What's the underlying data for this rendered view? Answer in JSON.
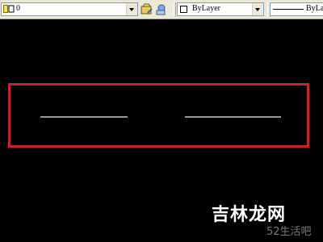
{
  "toolbar": {
    "layer_combo": {
      "value": "0"
    },
    "color_combo": {
      "value": "ByLayer"
    },
    "linetype_combo": {
      "value": "ByLay"
    }
  },
  "watermark": {
    "main_text": "吉林龙网",
    "sub_text": "52生活吧"
  },
  "colors": {
    "selection_frame": "#c0272d",
    "drawn_lines": "#9a9a9a",
    "canvas_background": "#000000"
  }
}
